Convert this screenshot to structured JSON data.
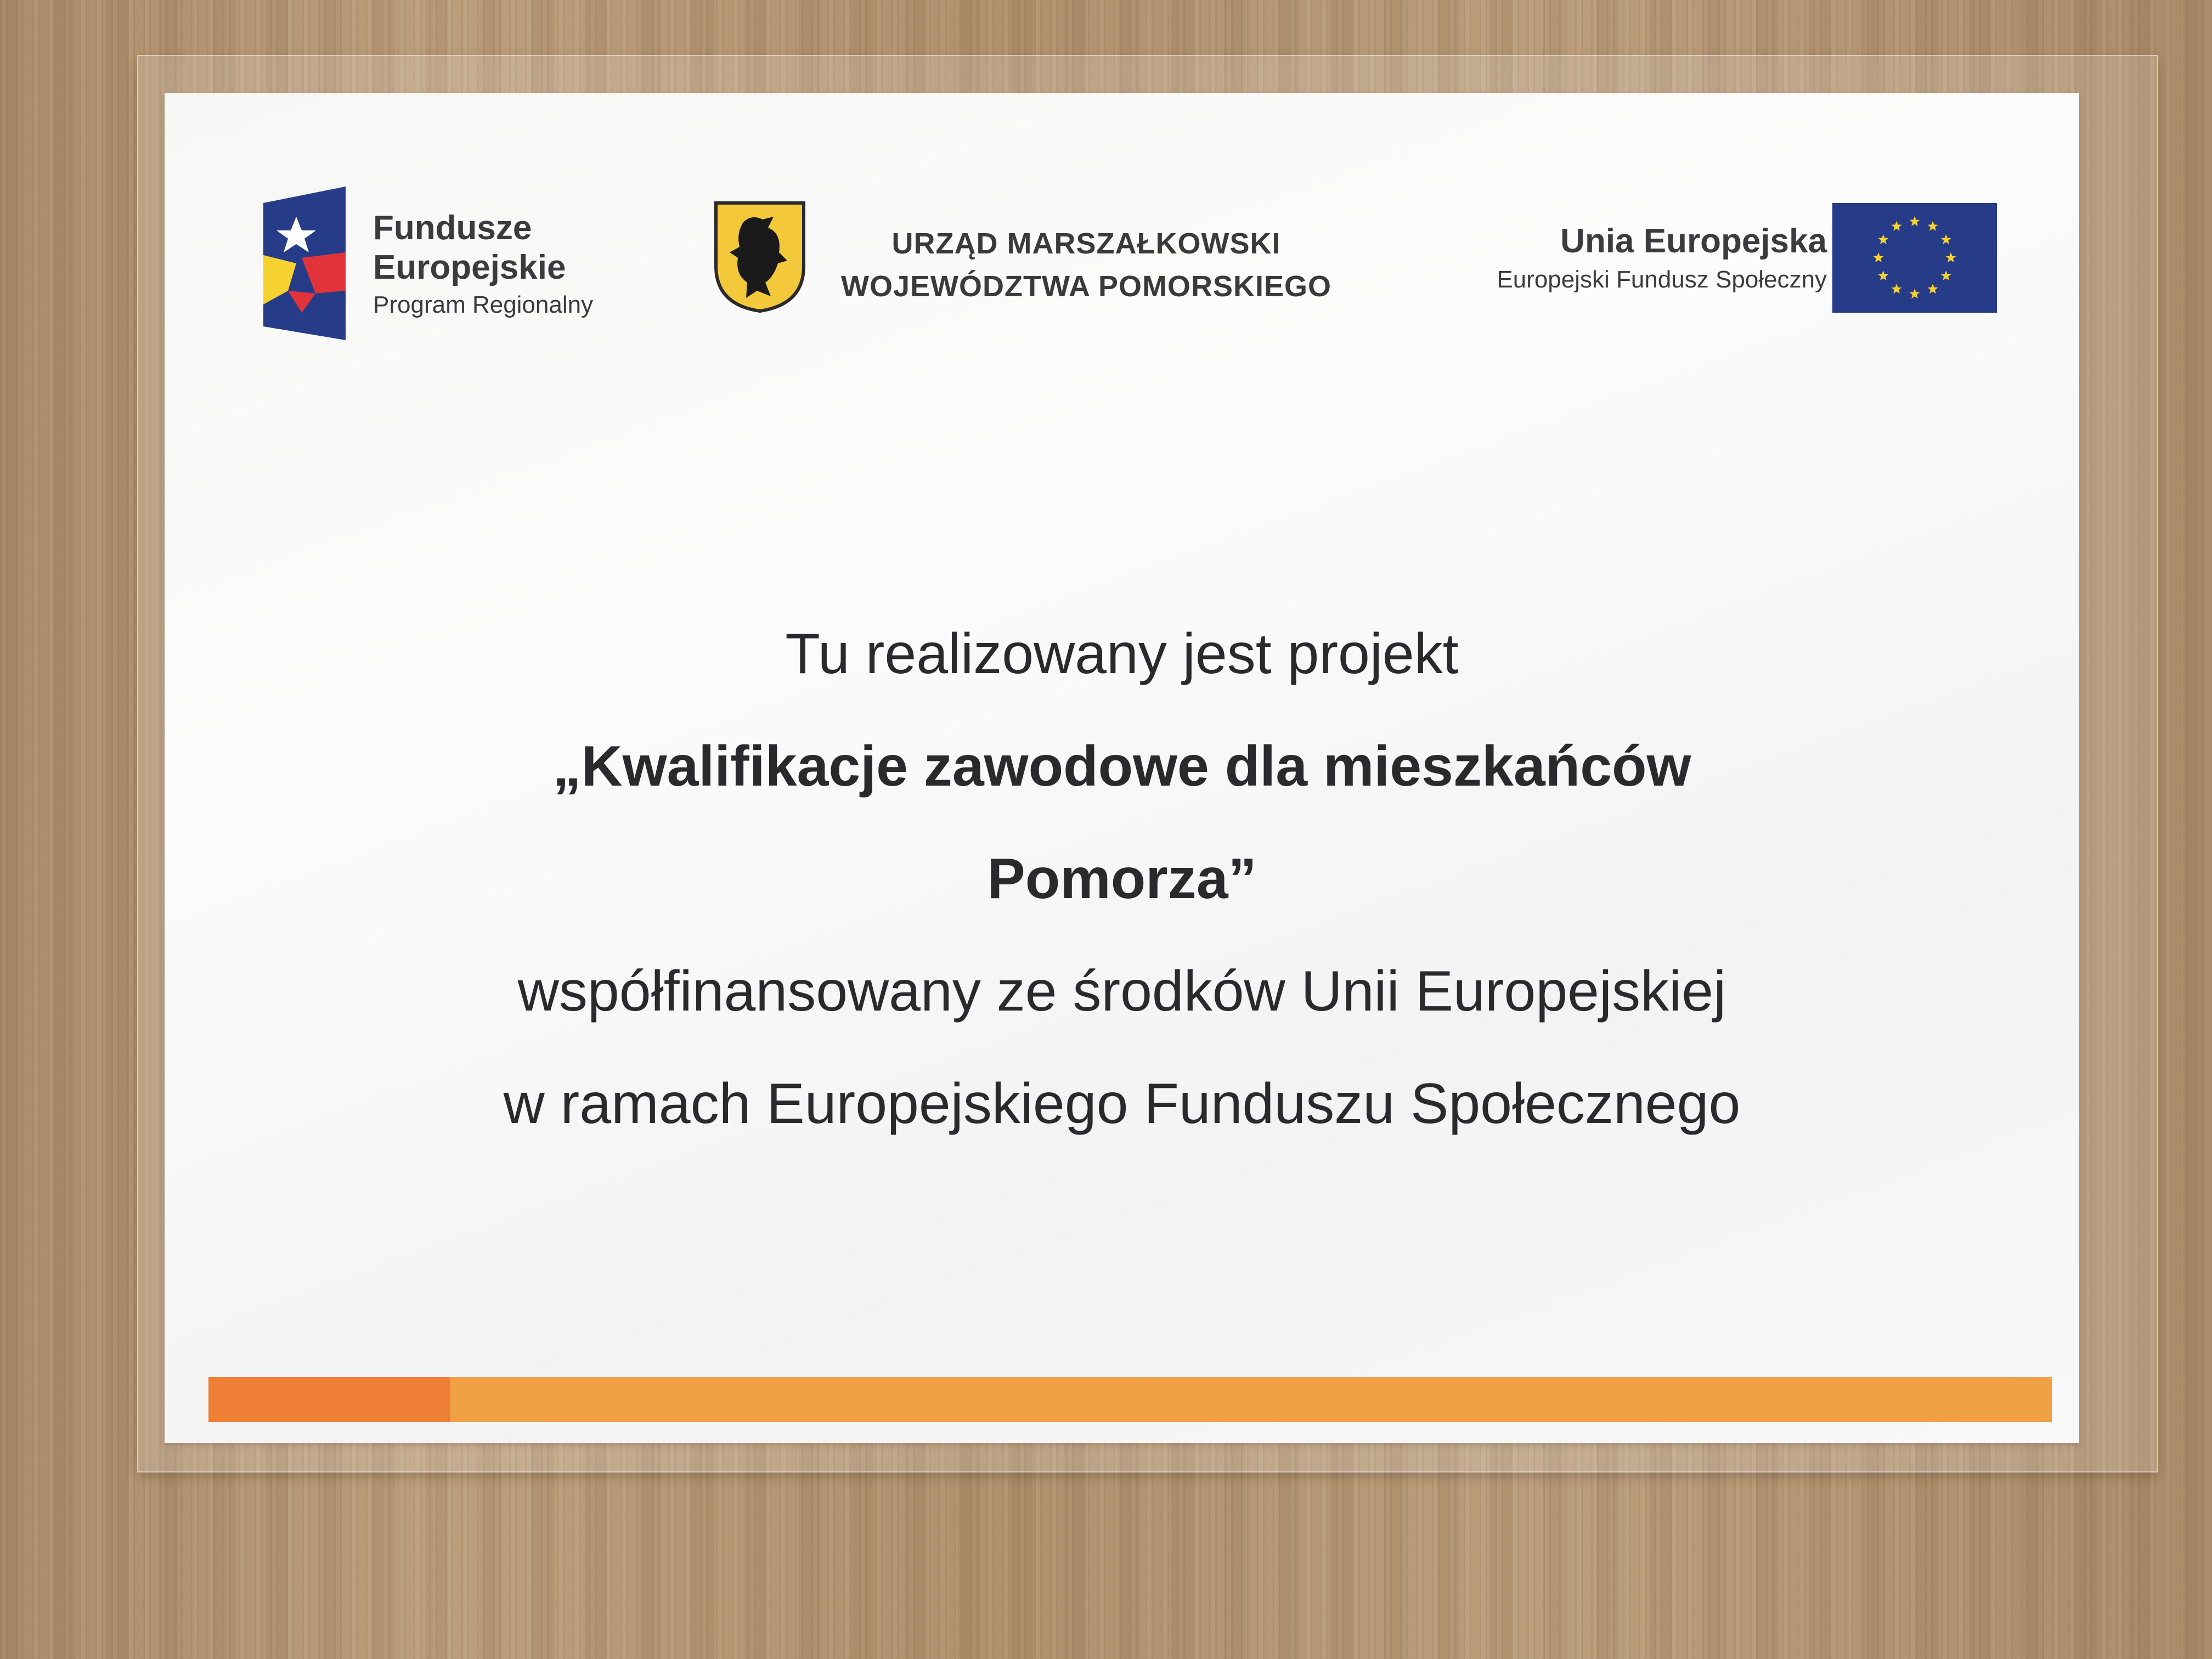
{
  "logos": {
    "fundusze": {
      "line1": "Fundusze",
      "line2": "Europejskie",
      "line3": "Program Regionalny",
      "icon": "fundusze-europejskie-star-icon"
    },
    "urzad": {
      "line1": "URZĄD MARSZAŁKOWSKI",
      "line2": "WOJEWÓDZTWA POMORSKIEGO",
      "icon": "griffin-crest-icon"
    },
    "ue": {
      "line1": "Unia Europejska",
      "line2": "Europejski Fundusz Społeczny",
      "icon": "eu-flag-icon"
    }
  },
  "body": {
    "line1": "Tu realizowany jest projekt",
    "line2": "„Kwalifikacje zawodowe dla mieszkańców",
    "line3": "Pomorza”",
    "line4": "współfinansowany ze środków Unii Europejskiej",
    "line5": "w ramach Europejskiego Funduszu Społecznego"
  },
  "colors": {
    "eu_blue": "#273c88",
    "eu_star": "#f6d231",
    "bar_orange": "#f1a044",
    "bar_dark_orange": "#ee7f35"
  }
}
